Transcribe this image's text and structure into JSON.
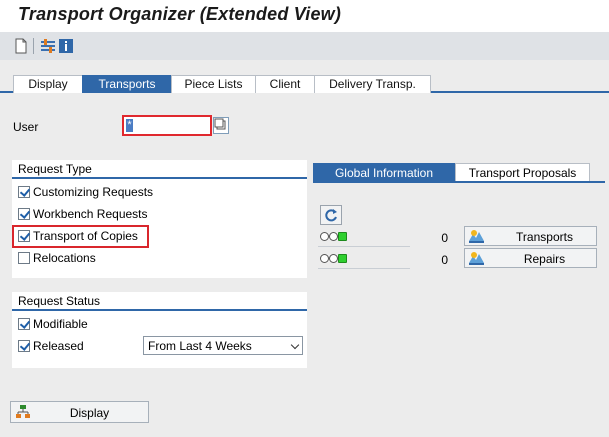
{
  "window": {
    "title": "Transport Organizer (Extended View)"
  },
  "toolbar": {
    "buttons": [
      {
        "icon": "new-document-icon"
      },
      {
        "icon": "settings-icon"
      },
      {
        "icon": "info-icon"
      }
    ]
  },
  "tabs": [
    {
      "label": "Display",
      "active": false
    },
    {
      "label": "Transports",
      "active": true
    },
    {
      "label": "Piece Lists",
      "active": false
    },
    {
      "label": "Client",
      "active": false
    },
    {
      "label": "Delivery Transp.",
      "active": false
    }
  ],
  "user": {
    "label": "User",
    "value": "*"
  },
  "request_type": {
    "title": "Request Type",
    "items": [
      {
        "label": "Customizing Requests",
        "checked": true
      },
      {
        "label": "Workbench Requests",
        "checked": true
      },
      {
        "label": "Transport of Copies",
        "checked": true,
        "highlighted": true
      },
      {
        "label": "Relocations",
        "checked": false
      }
    ]
  },
  "request_status": {
    "title": "Request Status",
    "items": [
      {
        "label": "Modifiable",
        "checked": true
      },
      {
        "label": "Released",
        "checked": true
      }
    ],
    "period": {
      "selected": "From Last 4 Weeks"
    }
  },
  "display_button": {
    "label": "Display"
  },
  "right_tabs": [
    {
      "label": "Global Information",
      "active": true
    },
    {
      "label": "Transport Proposals",
      "active": false
    }
  ],
  "global_info": {
    "rows": [
      {
        "count": "0",
        "button": "Transports"
      },
      {
        "count": "0",
        "button": "Repairs"
      }
    ]
  },
  "colors": {
    "accent": "#2f67a8",
    "highlight": "#d9262c",
    "status_green": "#2fcf2f"
  }
}
